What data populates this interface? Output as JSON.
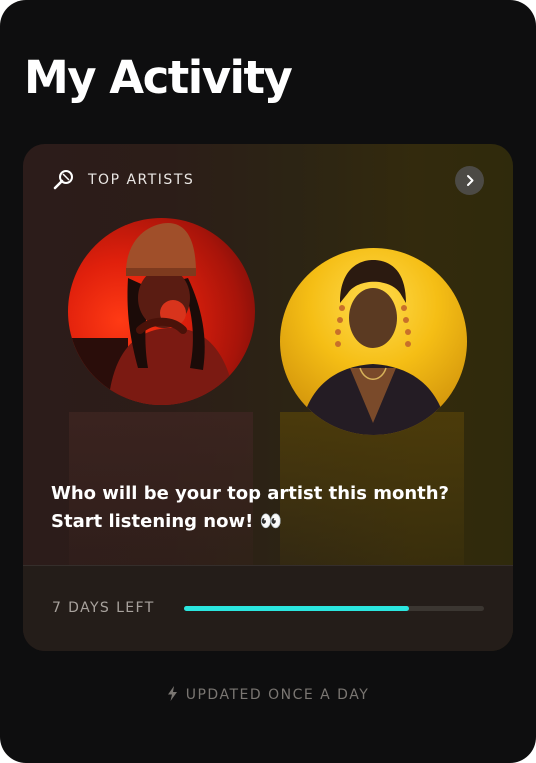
{
  "page": {
    "title": "My Activity"
  },
  "card": {
    "header_icon": "microphone-icon",
    "header_label": "TOP ARTISTS",
    "open_icon": "chevron-right-icon",
    "artists": [
      {
        "image": "artist-photo-red"
      },
      {
        "image": "artist-photo-yellow"
      }
    ],
    "message": "Who will be your top artist this month? Start listening now! 👀",
    "footer": {
      "days_left_label": "7 DAYS LEFT",
      "progress_fraction": 0.75
    }
  },
  "status": {
    "icon": "lightning-icon",
    "label": "UPDATED ONCE A DAY"
  },
  "colors": {
    "background": "#0e0e0f",
    "progress_fill": "#2be6df",
    "progress_track": "#3b3631",
    "card_warm": "#2c1c1a",
    "card_gold": "#332a0d"
  }
}
